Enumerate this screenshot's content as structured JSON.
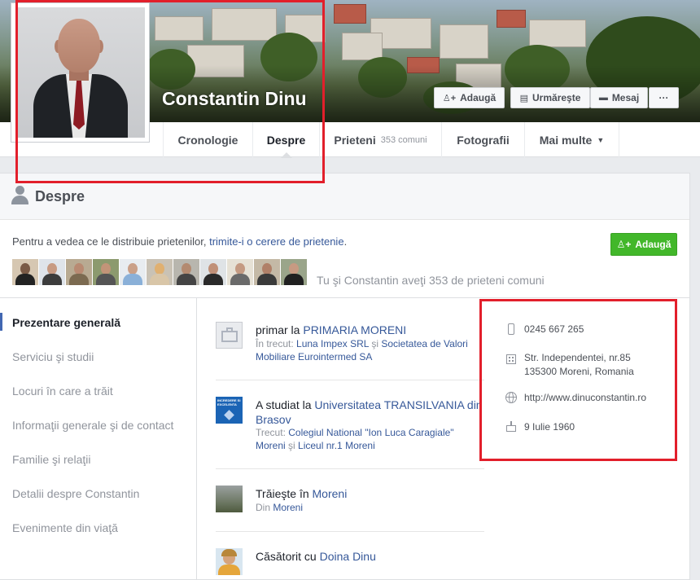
{
  "profile": {
    "name": "Constantin Dinu"
  },
  "cover_buttons": {
    "add": "Adaugă",
    "follow": "Urmăreşte",
    "message": "Mesaj",
    "more": "···"
  },
  "nav": {
    "tabs": [
      {
        "label": "Cronologie"
      },
      {
        "label": "Despre"
      },
      {
        "label": "Prieteni",
        "sub": "353 comuni"
      },
      {
        "label": "Fotografii"
      },
      {
        "label": "Mai multe"
      }
    ]
  },
  "about": {
    "title": "Despre",
    "friend_prompt_prefix": "Pentru a vedea ce le distribuie prietenilor, ",
    "friend_prompt_link": "trimite-i o cerere de prietenie",
    "friend_prompt_suffix": ".",
    "add_friend_label": "Adaugă",
    "mutual_text": "Tu şi Constantin aveţi 353 de prieteni comuni"
  },
  "left_menu": [
    "Prezentare generală",
    "Serviciu şi studii",
    "Locuri în care a trăit",
    "Informaţii generale şi de contact",
    "Familie şi relaţii",
    "Detalii despre Constantin",
    "Evenimente din viaţă"
  ],
  "overview": {
    "work": {
      "prefix": "primar la ",
      "employer": "PRIMARIA MORENI",
      "past_label": "În trecut: ",
      "past_1": "Luna Impex SRL",
      "past_and": " şi ",
      "past_2": "Societatea de Valori Mobiliare Eurointermed SA"
    },
    "education": {
      "prefix": "A studiat la ",
      "school": "Universitatea TRANSILVANIA din Brasov",
      "past_label": "Trecut: ",
      "past_1": "Colegiul National \"Ion Luca Caragiale\" Moreni",
      "past_and": " şi ",
      "past_2": "Liceul nr.1 Moreni",
      "logo_text": "INCREDERE SI EXCELENTA"
    },
    "lives": {
      "prefix": "Trăieşte în ",
      "city": "Moreni",
      "from_label": "Din ",
      "from_city": "Moreni"
    },
    "relationship": {
      "prefix": "Căsătorit cu ",
      "partner": "Doina Dinu"
    }
  },
  "contact": {
    "phone": "0245 667 265",
    "address_line1": "Str. Independentei, nr.85",
    "address_line2": "135300 Moreni, Romania",
    "website": "http://www.dinuconstantin.ro",
    "birthday": "9 Iulie 1960"
  },
  "colors": {
    "link": "#365899",
    "green": "#42b72a",
    "highlight": "#e21f2b"
  }
}
